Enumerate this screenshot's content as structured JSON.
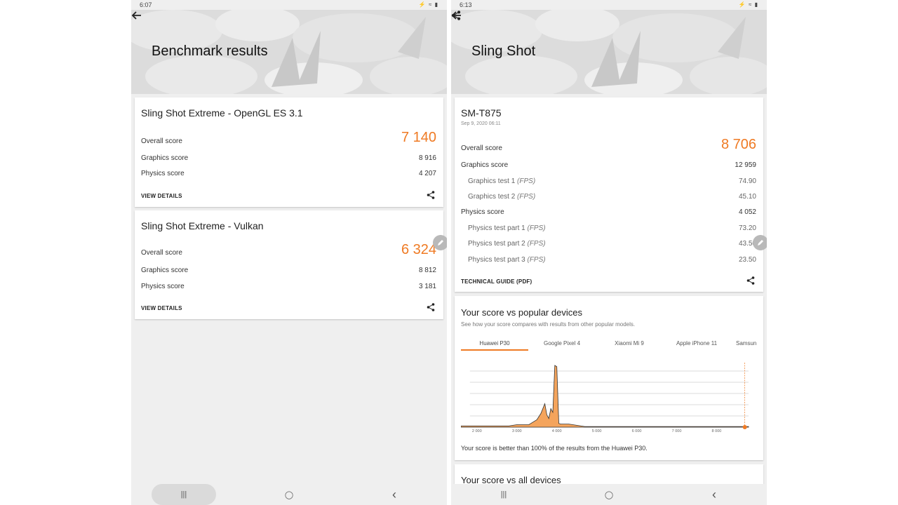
{
  "left": {
    "status": {
      "time": "6:07",
      "icons": "⚡ ≈ ▮"
    },
    "title": "Benchmark results",
    "cards": [
      {
        "title": "Sling Shot Extreme - OpenGL ES 3.1",
        "overall_label": "Overall score",
        "overall_value": "7 140",
        "graphics_label": "Graphics score",
        "graphics_value": "8 916",
        "physics_label": "Physics score",
        "physics_value": "4 207",
        "link": "VIEW DETAILS"
      },
      {
        "title": "Sling Shot Extreme - Vulkan",
        "overall_label": "Overall score",
        "overall_value": "6 324",
        "graphics_label": "Graphics score",
        "graphics_value": "8 812",
        "physics_label": "Physics score",
        "physics_value": "3 181",
        "link": "VIEW DETAILS"
      }
    ],
    "nav": {
      "recents": "|||",
      "home": "◯",
      "back": "‹"
    }
  },
  "right": {
    "status": {
      "time": "6:13",
      "icons": "⚡ ≈ ▮"
    },
    "title": "Sling Shot",
    "device": {
      "name": "SM-T875",
      "date": "Sep 9, 2020 06:11",
      "overall_label": "Overall score",
      "overall_value": "8 706",
      "graphics_label": "Graphics score",
      "graphics_value": "12 959",
      "graphics_tests": [
        {
          "label": "Graphics test 1",
          "unit": "(FPS)",
          "value": "74.90"
        },
        {
          "label": "Graphics test 2",
          "unit": "(FPS)",
          "value": "45.10"
        }
      ],
      "physics_label": "Physics score",
      "physics_value": "4 052",
      "physics_tests": [
        {
          "label": "Physics test part 1",
          "unit": "(FPS)",
          "value": "73.20"
        },
        {
          "label": "Physics test part 2",
          "unit": "(FPS)",
          "value": "43.50"
        },
        {
          "label": "Physics test part 3",
          "unit": "(FPS)",
          "value": "23.50"
        }
      ],
      "link": "TECHNICAL GUIDE (PDF)"
    },
    "compare": {
      "title": "Your score vs popular devices",
      "subtitle": "See how your score compares with results from other popular models.",
      "tabs": [
        "Huawei P30",
        "Google Pixel 4",
        "Xiaomi Mi 9",
        "Apple iPhone 11",
        "Samsung"
      ],
      "footnote": "Your score is better than 100% of the results from the Huawei P30."
    },
    "all_devices_title": "Your score vs all devices",
    "nav": {
      "recents": "|||",
      "home": "◯",
      "back": "‹"
    }
  },
  "chart_data": {
    "type": "area",
    "x_ticks": [
      "2 000",
      "3 000",
      "4 000",
      "5 000",
      "6 000",
      "7 000",
      "8 000"
    ],
    "xlim": [
      1600,
      8800
    ],
    "ylim": [
      0,
      1
    ],
    "grid": true,
    "x": [
      1600,
      2800,
      3000,
      3300,
      3500,
      3600,
      3700,
      3750,
      3800,
      3850,
      3900,
      3950,
      4000,
      4050,
      4100,
      4200,
      4300,
      4500,
      4600,
      4700,
      8800
    ],
    "values": [
      0.02,
      0.02,
      0.04,
      0.04,
      0.12,
      0.22,
      0.38,
      0.2,
      0.14,
      0.3,
      0.24,
      1.0,
      0.98,
      0.06,
      0.05,
      0.05,
      0.05,
      0.03,
      0.02,
      0.01,
      0.01
    ],
    "marker_x": 8706,
    "fill_color": "#f4a45c",
    "line_color": "#333333",
    "marker_color": "#ef7a23"
  }
}
